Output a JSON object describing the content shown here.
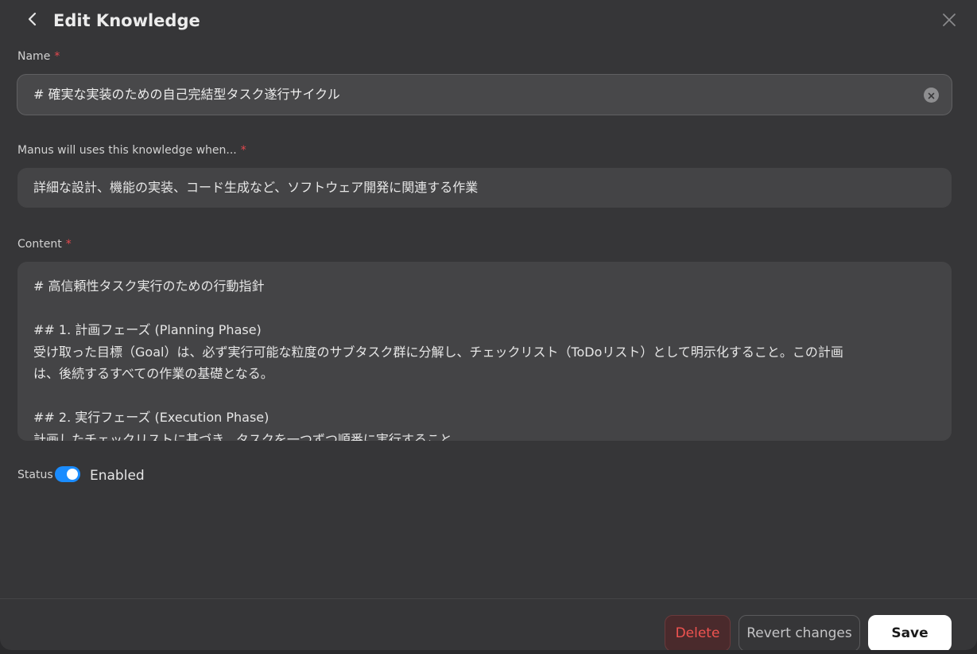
{
  "header": {
    "title": "Edit Knowledge",
    "back_icon": "chevron-left-icon",
    "close_icon": "close-icon"
  },
  "form": {
    "name": {
      "label": "Name",
      "required_mark": "*",
      "value": "# 確実な実装のための自己完結型タスク遂行サイクル"
    },
    "when": {
      "label": "Manus will uses this knowledge when...",
      "required_mark": "*",
      "value": "詳細な設計、機能の実装、コード生成など、ソフトウェア開発に関連する作業"
    },
    "content": {
      "label": "Content",
      "required_mark": "*",
      "lines": [
        "# 高信頼性タスク実行のための行動指針",
        "",
        "## 1. 計画フェーズ (Planning Phase)",
        "受け取った目標（Goal）は、必ず実行可能な粒度のサブタスク群に分解し、チェックリスト（ToDoリスト）として明示化すること。この計画",
        "は、後続するすべての作業の基礎となる。",
        "",
        "## 2. 実行フェーズ (Execution Phase)",
        "計画したチェックリストに基づき、タスクを一つずつ順番に実行すること。"
      ]
    },
    "status": {
      "label": "Status",
      "enabled": true,
      "value": "Enabled"
    }
  },
  "footer": {
    "delete_label": "Delete",
    "revert_label": "Revert changes",
    "save_label": "Save"
  },
  "colors": {
    "accent": "#1a8cff",
    "danger": "#ef5350",
    "required": "#e5484d",
    "background": "#363638"
  }
}
